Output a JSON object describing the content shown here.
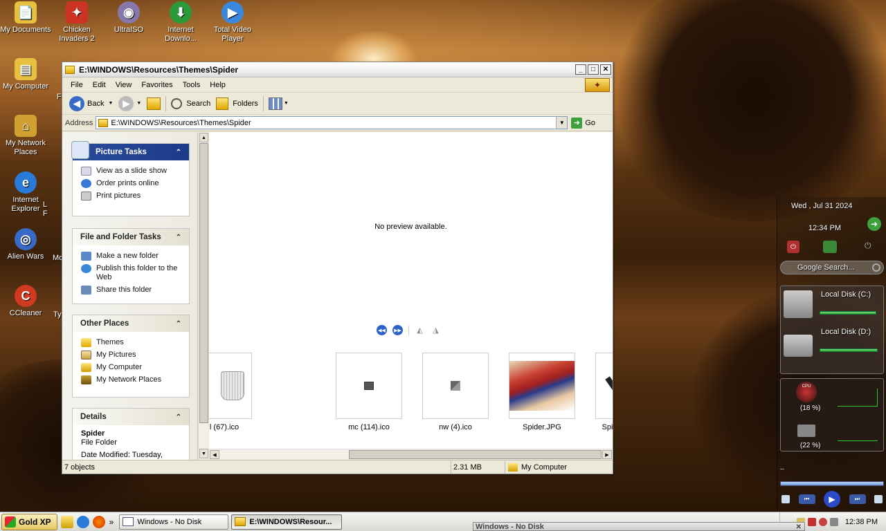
{
  "desktop": {
    "icons": [
      {
        "label": "My Documents",
        "icon": "my-documents-icon",
        "color": "#e8c040"
      },
      {
        "label": "Chicken Invaders 2",
        "icon": "chicken-invaders-icon",
        "color": "#cc3322"
      },
      {
        "label": "UltraISO",
        "icon": "ultraiso-icon",
        "color": "#8877aa"
      },
      {
        "label": "Internet Downlo...",
        "icon": "internet-download-manager-icon",
        "color": "#2a9a3a"
      },
      {
        "label": "Total Video Player",
        "icon": "total-video-player-icon",
        "color": "#3a88dd"
      },
      {
        "label": "My Computer",
        "icon": "my-computer-icon",
        "color": "#e8c040"
      },
      {
        "label": "My Network Places",
        "icon": "my-network-places-icon",
        "color": "#d0a030"
      },
      {
        "label": "Internet Explorer",
        "icon": "internet-explorer-icon",
        "color": "#2a7ad8"
      },
      {
        "label": "Alien Wars",
        "icon": "alien-wars-icon",
        "color": "#3a6ac8"
      },
      {
        "label": "CCleaner",
        "icon": "ccleaner-icon",
        "color": "#d03a20"
      }
    ],
    "partial_labels": {
      "ie_right": "L\nF",
      "alien_right": "Mo",
      "ccleaner_right": "Ty",
      "mycomp_right": "F"
    }
  },
  "window": {
    "title": "E:\\WINDOWS\\Resources\\Themes\\Spider",
    "controls": {
      "minimize": "_",
      "maximize": "□",
      "close": "✕"
    },
    "menu": [
      "File",
      "Edit",
      "View",
      "Favorites",
      "Tools",
      "Help"
    ],
    "toolbar": {
      "back": "Back",
      "search": "Search",
      "folders": "Folders"
    },
    "address": {
      "label": "Address",
      "value": "E:\\WINDOWS\\Resources\\Themes\\Spider",
      "go": "Go"
    }
  },
  "tasks": {
    "picture": {
      "title": "Picture Tasks",
      "items": [
        {
          "label": "View as a slide show",
          "icon": "slideshow-icon"
        },
        {
          "label": "Order prints online",
          "icon": "order-prints-icon"
        },
        {
          "label": "Print pictures",
          "icon": "print-icon"
        }
      ]
    },
    "file": {
      "title": "File and Folder Tasks",
      "items": [
        {
          "label": "Make a new folder",
          "icon": "new-folder-icon"
        },
        {
          "label": "Publish this folder to the Web",
          "icon": "publish-web-icon"
        },
        {
          "label": "Share this folder",
          "icon": "share-folder-icon"
        }
      ]
    },
    "places": {
      "title": "Other Places",
      "items": [
        {
          "label": "Themes",
          "icon": "folder-icon"
        },
        {
          "label": "My Pictures",
          "icon": "my-pictures-icon"
        },
        {
          "label": "My Computer",
          "icon": "my-computer-icon"
        },
        {
          "label": "My Network Places",
          "icon": "network-places-icon"
        }
      ]
    },
    "details": {
      "title": "Details",
      "name": "Spider",
      "type": "File Folder",
      "modified": "Date Modified: Tuesday,"
    }
  },
  "preview": {
    "message": "No preview available."
  },
  "files": [
    {
      "name": "l (67).ico",
      "icon": "trash-bin-icon"
    },
    {
      "name": "mc (114).ico",
      "icon": "computer-icon"
    },
    {
      "name": "nw (4).ico",
      "icon": "network-icon"
    },
    {
      "name": "Spider.JPG",
      "icon": "spiderman-image"
    },
    {
      "name": "Spider.msstyles",
      "icon": "msstyles-icon"
    }
  ],
  "status": {
    "objects": "7 objects",
    "size": "2.31 MB",
    "location": "My Computer"
  },
  "sidebar": {
    "date": "Wed , Jul 31 2024",
    "time": "12:34 PM",
    "search_placeholder": "Google Search...",
    "disk_c": "Local Disk (C:)",
    "disk_d": "Local Disk (D:)",
    "disk_c_used": 0.95,
    "disk_d_used": 0.97,
    "cpu_label": "CPU",
    "cpu_pct": "(18 %)",
    "ram_pct": "(22 %)",
    "media_time": "--"
  },
  "taskbar": {
    "start": "Gold XP",
    "overflow": "»",
    "tasks": [
      {
        "label": "Windows - No Disk",
        "active": false
      },
      {
        "label": "E:\\WINDOWS\\Resour...",
        "active": true
      }
    ],
    "clock": "12:38 PM",
    "ghost_title": "Windows - No Disk"
  },
  "colors": {
    "panel_blue": "#2a4a9a",
    "accent_green": "#3ca03c",
    "selection_blue": "#2a62c8"
  }
}
